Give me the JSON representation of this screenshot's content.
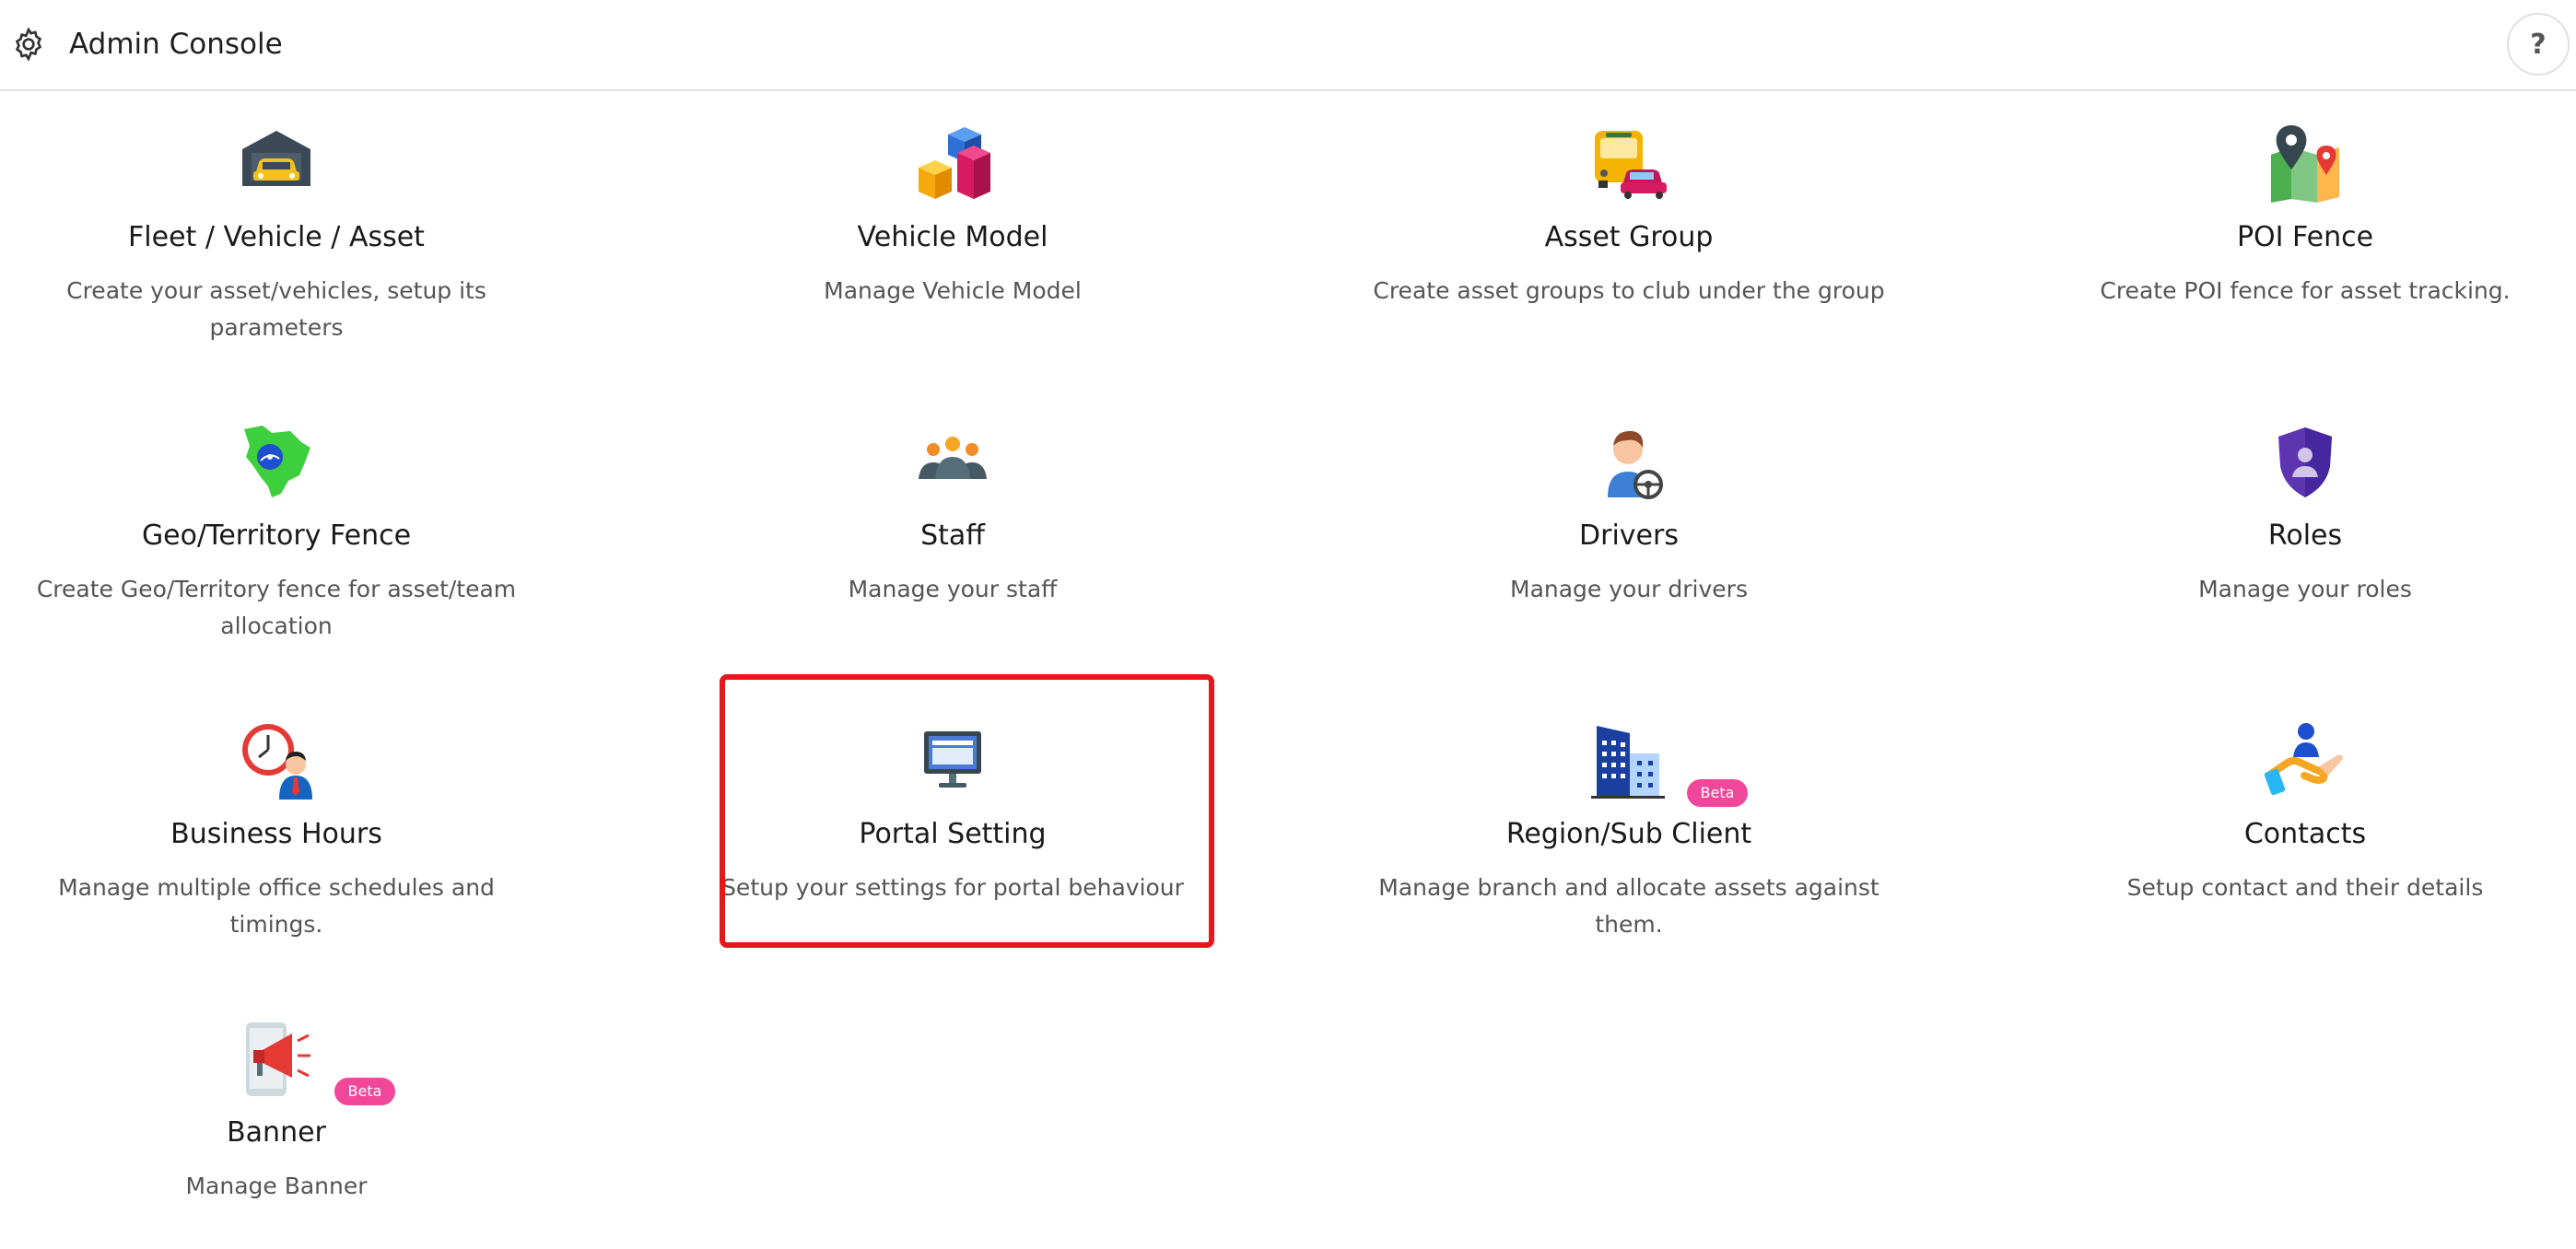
{
  "header": {
    "title": "Admin Console",
    "help_label": "?"
  },
  "cards": [
    {
      "title": "Fleet / Vehicle / Asset",
      "desc": "Create your asset/vehicles, setup its parameters",
      "icon": "car-garage-icon"
    },
    {
      "title": "Vehicle Model",
      "desc": "Manage Vehicle Model",
      "icon": "cubes-icon"
    },
    {
      "title": "Asset Group",
      "desc": "Create asset groups to club under the group",
      "icon": "bus-car-icon"
    },
    {
      "title": "POI Fence",
      "desc": "Create POI fence for asset tracking.",
      "icon": "map-pin-icon"
    },
    {
      "title": "Geo/Territory Fence",
      "desc": "Create Geo/Territory fence for asset/team allocation",
      "icon": "territory-map-icon"
    },
    {
      "title": "Staff",
      "desc": "Manage your staff",
      "icon": "staff-group-icon"
    },
    {
      "title": "Drivers",
      "desc": "Manage your drivers",
      "icon": "driver-icon"
    },
    {
      "title": "Roles",
      "desc": "Manage your roles",
      "icon": "shield-user-icon"
    },
    {
      "title": "Business Hours",
      "desc": "Manage multiple office schedules and timings.",
      "icon": "clock-person-icon"
    },
    {
      "title": "Portal Setting",
      "desc": "Setup your settings for portal behaviour",
      "icon": "monitor-icon"
    },
    {
      "title": "Region/Sub Client",
      "desc": "Manage branch and allocate assets against them.",
      "icon": "buildings-icon",
      "badge": "Beta"
    },
    {
      "title": "Contacts",
      "desc": "Setup contact and their details",
      "icon": "hand-contact-icon"
    },
    {
      "title": "Banner",
      "desc": "Manage Banner",
      "icon": "megaphone-icon",
      "badge": "Beta"
    }
  ],
  "colors": {
    "highlight": "#e8161b",
    "beta_badge": "#f0479a"
  }
}
